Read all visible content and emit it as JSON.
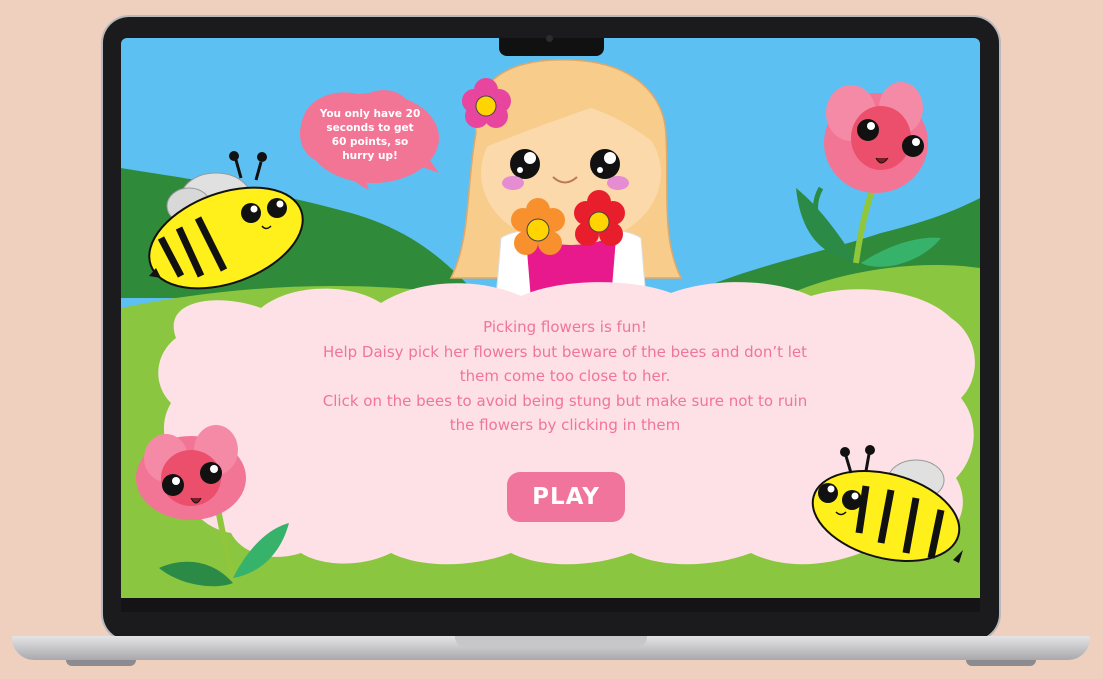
{
  "game": {
    "speech_bubble": "You only have 20 seconds to get 60 points, so hurry up!",
    "message_lines": [
      "Picking flowers is fun!",
      "Help Daisy pick her flowers but beware of the bees and don’t let",
      "them come too close to her.",
      "Click on the bees to avoid being stung but make sure not to ruin",
      "the flowers by clicking in them"
    ],
    "play_label": "PLAY"
  },
  "colors": {
    "page_background": "#efd0bf",
    "sky": "#5cc0f2",
    "dark_hill": "#2f8a3a",
    "light_hill": "#8ac63f",
    "cloud": "#fde1e6",
    "accent_pink": "#f0749c",
    "bee_yellow": "#ffef1a",
    "tulip_pink": "#f27596"
  }
}
